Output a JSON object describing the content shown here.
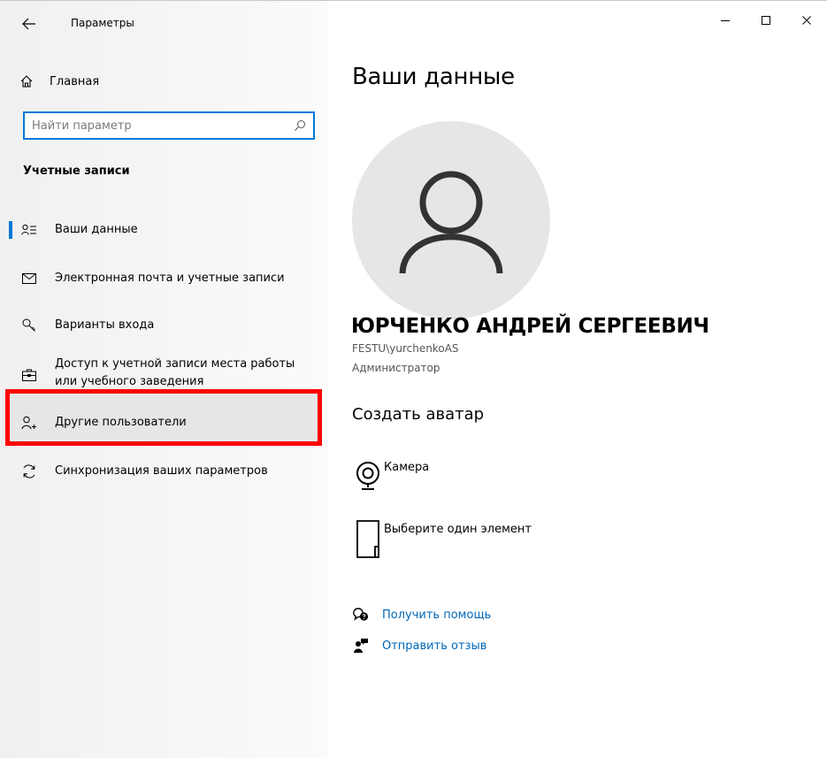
{
  "window": {
    "title": "Параметры"
  },
  "sidebar": {
    "home_label": "Главная",
    "search_placeholder": "Найти параметр",
    "section_title": "Учетные записи",
    "items": [
      {
        "label": "Ваши данные",
        "icon": "person-list-icon",
        "selected": true
      },
      {
        "label": "Электронная почта и учетные записи",
        "icon": "mail-icon"
      },
      {
        "label": "Варианты входа",
        "icon": "key-icon"
      },
      {
        "label": "Доступ к учетной записи места работы или учебного заведения",
        "icon": "briefcase-icon"
      },
      {
        "label": "Другие пользователи",
        "icon": "add-person-icon",
        "highlighted": true
      },
      {
        "label": "Синхронизация ваших параметров",
        "icon": "sync-icon"
      }
    ]
  },
  "main": {
    "title": "Ваши данные",
    "user_name": "ЮРЧЕНКО АНДРЕЙ СЕРГЕЕВИЧ",
    "account": "FESTU\\yurchenkoAS",
    "role": "Администратор",
    "create_avatar_title": "Создать аватар",
    "options": [
      {
        "label": "Камера",
        "icon": "camera-icon"
      },
      {
        "label": "Выберите один элемент",
        "icon": "file-icon"
      }
    ],
    "links": [
      {
        "label": "Получить помощь",
        "icon": "help-icon"
      },
      {
        "label": "Отправить отзыв",
        "icon": "feedback-icon"
      }
    ]
  },
  "colors": {
    "accent": "#0078d7",
    "link": "#0067b8",
    "highlight_border": "#ff0000"
  }
}
